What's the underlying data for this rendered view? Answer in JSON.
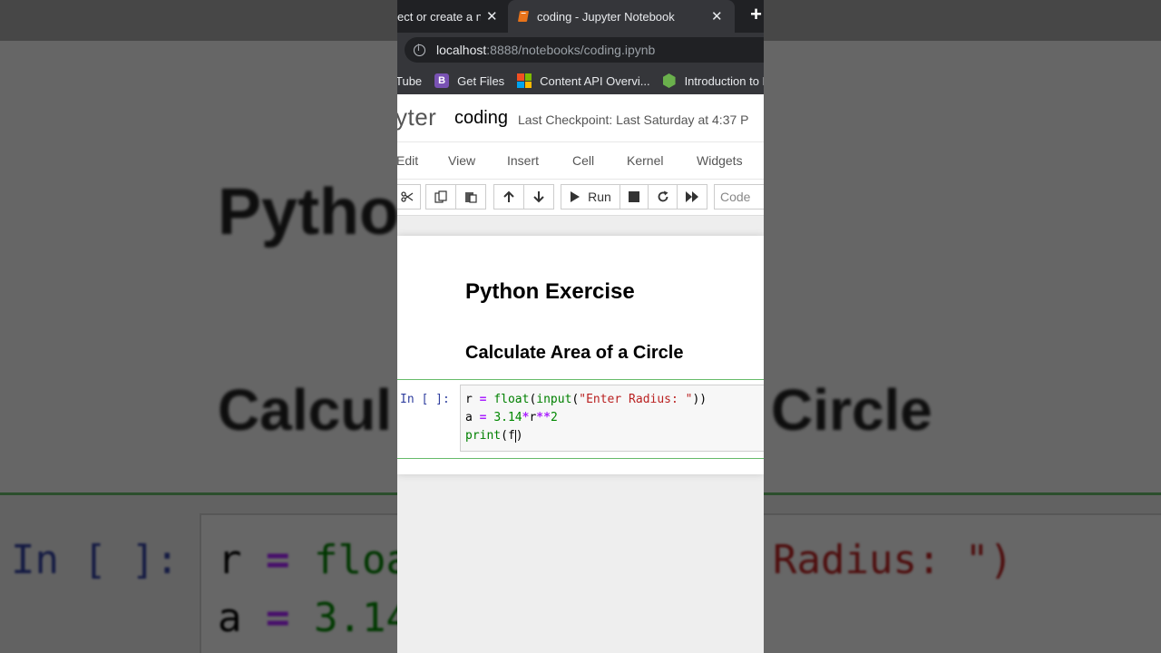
{
  "browser": {
    "tabs": [
      {
        "label": "ect or create a n",
        "active": false
      },
      {
        "label": "coding - Jupyter Notebook",
        "active": true
      }
    ],
    "close_glyph": "✕",
    "new_tab_glyph": "+",
    "url_host": "localhost",
    "url_rest": ":8888/notebooks/coding.ipynb",
    "bookmarks": [
      {
        "label": "Tube",
        "icon": "youtube-icon"
      },
      {
        "label": "Get Files",
        "icon": "bootstrap-icon"
      },
      {
        "label": "Content API Overvi...",
        "icon": "microsoft-icon"
      },
      {
        "label": "Introduction to N",
        "icon": "node-hexagon-icon"
      }
    ]
  },
  "jupyter": {
    "logo": "yter",
    "notebook_name": "coding",
    "checkpoint": "Last Checkpoint: Last Saturday at 4:37 P",
    "menu": [
      "Edit",
      "View",
      "Insert",
      "Cell",
      "Kernel",
      "Widgets"
    ],
    "toolbar": {
      "run_label": "Run",
      "cell_type": "Code"
    }
  },
  "cells": {
    "heading1": "Python Exercise",
    "heading2": "Calculate Area of a Circle",
    "prompt": "In [ ]:",
    "code": {
      "line1": {
        "var": "r",
        "eq": "=",
        "fn1": "float",
        "p1": "(",
        "fn2": "input",
        "p2": "(",
        "str": "\"Enter Radius: \"",
        "close": "))"
      },
      "line2": {
        "var": "a",
        "eq": "=",
        "num1": "3.14",
        "op1": "*",
        "var2": "r",
        "op2": "**",
        "num2": "2"
      },
      "line3": {
        "fn": "print",
        "rest": "(f",
        "close": ")"
      }
    }
  },
  "colors": {
    "accent_green": "#66bb6a",
    "tab_bar": "#202124",
    "active_tab": "#35363a"
  }
}
